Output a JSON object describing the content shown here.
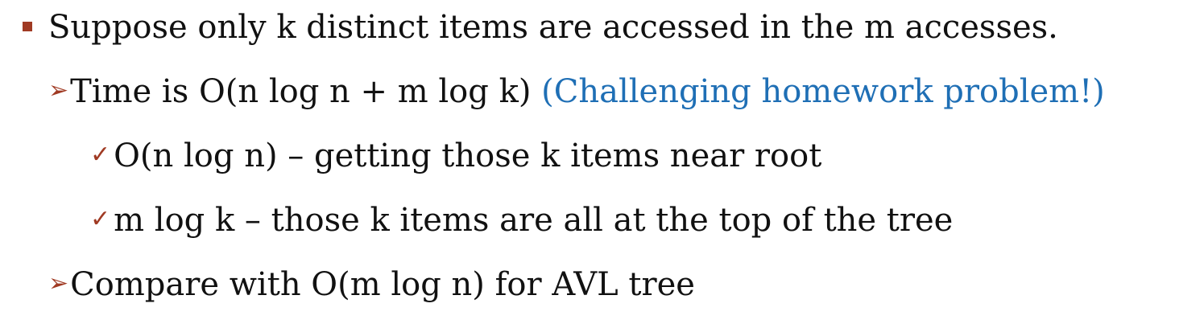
{
  "colors": {
    "bullet": "#a03a23",
    "accent": "#1f6fb5",
    "text": "#111111"
  },
  "bullets": {
    "level1_icon": "square-bullet-icon",
    "level2_icon": "arrow-bullet-icon",
    "level3_icon": "check-bullet-icon",
    "arrow_glyph": "➢",
    "check_glyph": "✓"
  },
  "lines": {
    "l1": "Suppose only k distinct items are accessed in the m accesses.",
    "l2_main": "Time is O(n log n + m log k) ",
    "l2_accent": "(Challenging homework problem!)",
    "l3": "O(n log n) – getting those k items near root",
    "l4": "m log k – those k items are all at the top of the tree",
    "l5": "Compare with O(m log n) for AVL tree"
  }
}
